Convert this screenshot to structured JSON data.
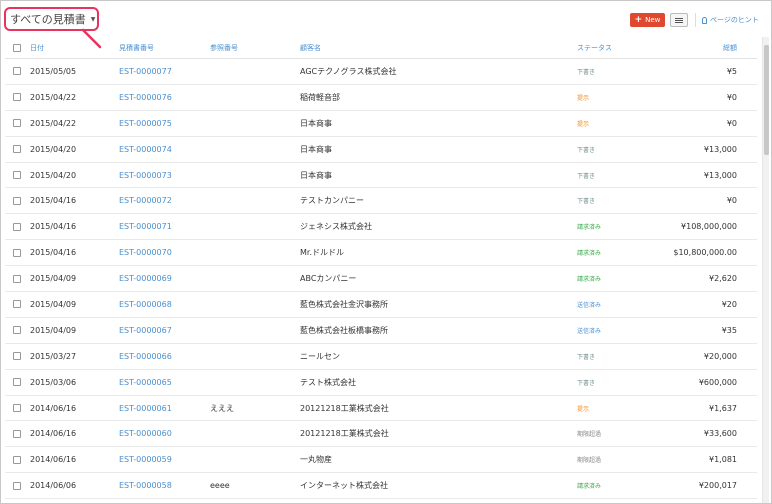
{
  "header": {
    "view_label": "すべての見積書",
    "new_button": "New",
    "hint_link": "ページのヒント"
  },
  "columns": {
    "date": "日付",
    "estimate_number": "見積書番号",
    "reference_number": "参照番号",
    "customer": "顧客名",
    "status": "ステータス",
    "total": "総額"
  },
  "rows": [
    {
      "date": "2015/05/05",
      "number": "EST-0000077",
      "ref": "",
      "customer": "AGCテクノグラス株式会社",
      "status": "下書き",
      "status_type": "gray",
      "total": "¥5"
    },
    {
      "date": "2015/04/22",
      "number": "EST-0000076",
      "ref": "",
      "customer": "稲荷軽音部",
      "status": "提示",
      "status_type": "orange",
      "total": "¥0"
    },
    {
      "date": "2015/04/22",
      "number": "EST-0000075",
      "ref": "",
      "customer": "日本商事",
      "status": "提示",
      "status_type": "orange",
      "total": "¥0"
    },
    {
      "date": "2015/04/20",
      "number": "EST-0000074",
      "ref": "",
      "customer": "日本商事",
      "status": "下書き",
      "status_type": "gray",
      "total": "¥13,000"
    },
    {
      "date": "2015/04/20",
      "number": "EST-0000073",
      "ref": "",
      "customer": "日本商事",
      "status": "下書き",
      "status_type": "gray",
      "total": "¥13,000"
    },
    {
      "date": "2015/04/16",
      "number": "EST-0000072",
      "ref": "",
      "customer": "テストカンパニー",
      "status": "下書き",
      "status_type": "gray",
      "total": "¥0"
    },
    {
      "date": "2015/04/16",
      "number": "EST-0000071",
      "ref": "",
      "customer": "ジェネシス株式会社",
      "status": "請求済み",
      "status_type": "green",
      "total": "¥108,000,000"
    },
    {
      "date": "2015/04/16",
      "number": "EST-0000070",
      "ref": "",
      "customer": "Mr.ドルドル",
      "status": "請求済み",
      "status_type": "green",
      "total": "$10,800,000.00"
    },
    {
      "date": "2015/04/09",
      "number": "EST-0000069",
      "ref": "",
      "customer": "ABCカンパニー",
      "status": "請求済み",
      "status_type": "green",
      "total": "¥2,620"
    },
    {
      "date": "2015/04/09",
      "number": "EST-0000068",
      "ref": "",
      "customer": "藍色株式会社金沢事務所",
      "status": "送信済み",
      "status_type": "blue",
      "total": "¥20"
    },
    {
      "date": "2015/04/09",
      "number": "EST-0000067",
      "ref": "",
      "customer": "藍色株式会社板橋事務所",
      "status": "送信済み",
      "status_type": "blue",
      "total": "¥35"
    },
    {
      "date": "2015/03/27",
      "number": "EST-0000066",
      "ref": "",
      "customer": "ニールセン",
      "status": "下書き",
      "status_type": "gray",
      "total": "¥20,000"
    },
    {
      "date": "2015/03/06",
      "number": "EST-0000065",
      "ref": "",
      "customer": "テスト株式会社",
      "status": "下書き",
      "status_type": "gray",
      "total": "¥600,000"
    },
    {
      "date": "2014/06/16",
      "number": "EST-0000061",
      "ref": "えええ",
      "customer": "20121218工業株式会社",
      "status": "提示",
      "status_type": "orange",
      "total": "¥1,637"
    },
    {
      "date": "2014/06/16",
      "number": "EST-0000060",
      "ref": "",
      "customer": "20121218工業株式会社",
      "status": "期限超過",
      "status_type": "red",
      "total": "¥33,600"
    },
    {
      "date": "2014/06/16",
      "number": "EST-0000059",
      "ref": "",
      "customer": "一丸物産",
      "status": "期限超過",
      "status_type": "red",
      "total": "¥1,081"
    },
    {
      "date": "2014/06/06",
      "number": "EST-0000058",
      "ref": "eeee",
      "customer": "インターネット株式会社",
      "status": "請求済み",
      "status_type": "green",
      "total": "¥200,017"
    }
  ],
  "colors": {
    "accent_link": "#4a8fcf",
    "new_button": "#e0492f",
    "callout_border": "#e8335f"
  }
}
